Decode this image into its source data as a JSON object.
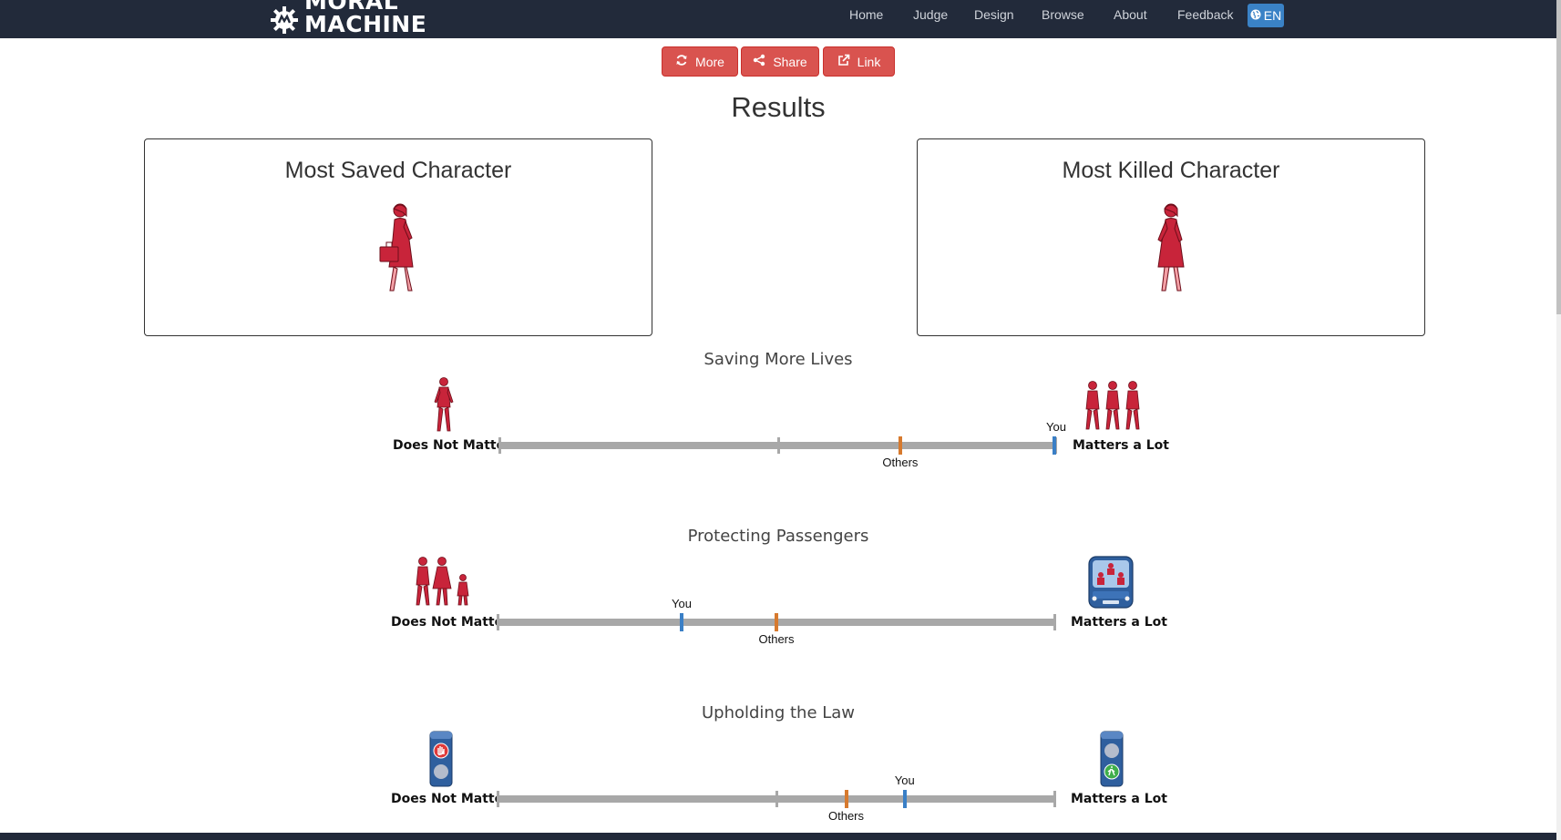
{
  "brand": {
    "line1": "MORAL",
    "line2": "MACHINE"
  },
  "nav": {
    "items": [
      "Home",
      "Judge",
      "Design",
      "Browse",
      "About",
      "Feedback"
    ],
    "language": "EN"
  },
  "actions": {
    "more": "More",
    "share": "Share",
    "link": "Link"
  },
  "page_title": "Results",
  "cards": {
    "saved_title": "Most Saved Character",
    "killed_title": "Most Killed Character"
  },
  "scale_labels": {
    "left": "Does Not Matter",
    "right": "Matters a Lot"
  },
  "markers": {
    "you": "You",
    "others": "Others"
  },
  "colors": {
    "you": "#3a7fc6",
    "others": "#d77a2e",
    "button": "#d9534f",
    "navbar": "#222a3a",
    "character": "#c8243a"
  },
  "sections": [
    {
      "title": "Saving More Lives",
      "you": 1.0,
      "others": 0.72
    },
    {
      "title": "Protecting Passengers",
      "you": 0.33,
      "others": 0.5
    },
    {
      "title": "Upholding the Law",
      "you": 0.73,
      "others": 0.625
    }
  ]
}
